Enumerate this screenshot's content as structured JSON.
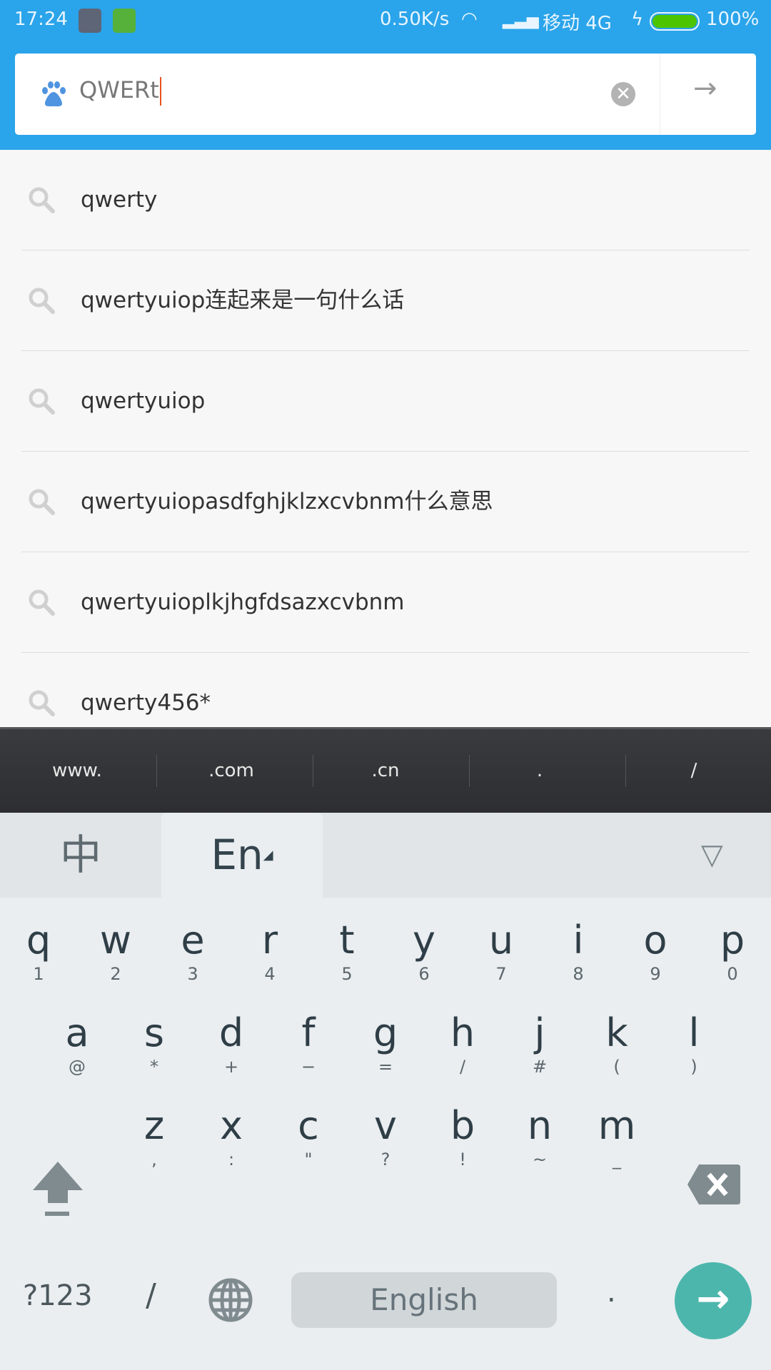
{
  "status_bar": {
    "time": "17:24",
    "net_speed": "0.50K/s",
    "carrier": "移动 4G",
    "battery": "100%",
    "battery_level": 100,
    "colors": {
      "bar": "#2aa4ea",
      "battery": "#4cc400"
    },
    "icons": [
      "screenshot-app-icon",
      "android-app-icon",
      "wifi-icon",
      "signal-icon",
      "charging-icon",
      "battery-icon"
    ]
  },
  "search": {
    "value": "QWERt",
    "icons": [
      "baidu-paw-icon",
      "clear-icon",
      "go-arrow-icon"
    ]
  },
  "suggestions": [
    "qwerty",
    "qwertyuiop连起来是一句什么话",
    "qwertyuiop",
    "qwertyuiopasdfghjklzxcvbnm什么意思",
    "qwertyuioplkjhgfdsazxcvbnm",
    "qwerty456*"
  ],
  "shortcut_bar": [
    "www.",
    ".com",
    ".cn",
    ".",
    "/"
  ],
  "keyboard": {
    "tabs": {
      "chinese": "中",
      "english": "En",
      "selected": "En"
    },
    "row1": [
      [
        "q",
        "1"
      ],
      [
        "w",
        "2"
      ],
      [
        "e",
        "3"
      ],
      [
        "r",
        "4"
      ],
      [
        "t",
        "5"
      ],
      [
        "y",
        "6"
      ],
      [
        "u",
        "7"
      ],
      [
        "i",
        "8"
      ],
      [
        "o",
        "9"
      ],
      [
        "p",
        "0"
      ]
    ],
    "row2": [
      [
        "a",
        "@"
      ],
      [
        "s",
        "*"
      ],
      [
        "d",
        "+"
      ],
      [
        "f",
        "−"
      ],
      [
        "g",
        "="
      ],
      [
        "h",
        "/"
      ],
      [
        "j",
        "#"
      ],
      [
        "k",
        "("
      ],
      [
        "l",
        ")"
      ]
    ],
    "row3": [
      [
        "z",
        ","
      ],
      [
        "x",
        ":"
      ],
      [
        "c",
        "\""
      ],
      [
        "v",
        "?"
      ],
      [
        "b",
        "!"
      ],
      [
        "n",
        "~"
      ],
      [
        "m",
        "_"
      ]
    ],
    "symbols": "?123",
    "slash": "/",
    "space": "English",
    "period": ".",
    "enter_color": "#4db6ac"
  }
}
